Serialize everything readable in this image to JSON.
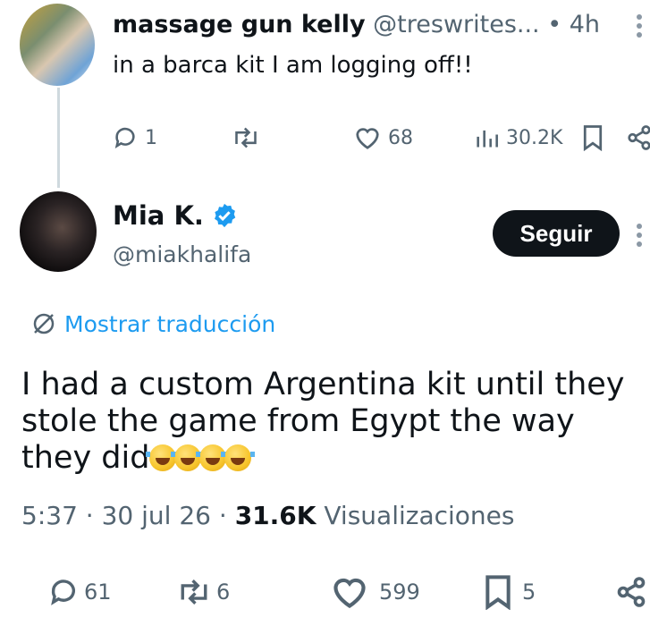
{
  "tweet1": {
    "display_name": "massage gun kelly",
    "handle_time": "@treswrites... • 4h",
    "text": "in a barca kit I am logging off!!",
    "actions": {
      "replies": "1",
      "likes": "68",
      "views": "30.2K"
    }
  },
  "tweet2": {
    "display_name": "Mia K.",
    "handle": "@miakhalifa",
    "follow_label": "Seguir",
    "translate_label": "Mostrar traducción",
    "text": "I had a custom Argentina kit until they stole the game from Egypt the way they did",
    "emoji_count": 4,
    "time": "5:37",
    "date": "30 jul 26",
    "views_count": "31.6K",
    "views_label": "Visualizaciones",
    "actions": {
      "replies": "61",
      "retweets": "6",
      "likes": "599",
      "bookmarks": "5"
    }
  },
  "colors": {
    "link": "#1d9bf0",
    "verified": "#1d9bf0",
    "muted": "#536471"
  }
}
